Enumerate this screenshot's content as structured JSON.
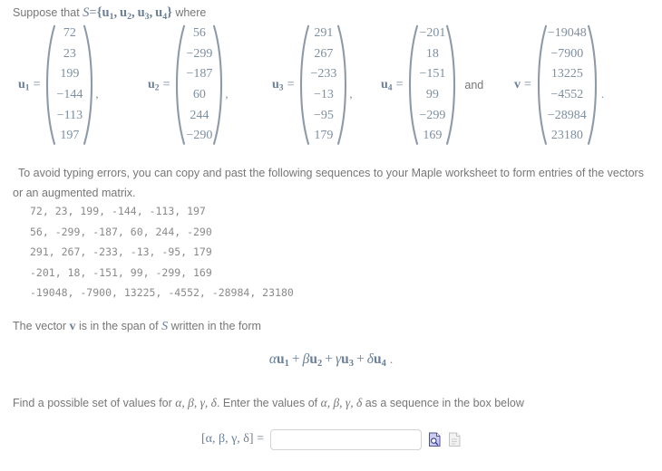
{
  "problem": {
    "intro_prefix": "Suppose that",
    "set_name": "S",
    "set_equals": "=",
    "set_contents": "{u1, u2, u3, u4}",
    "intro_suffix": "where",
    "equals_sign": "=",
    "connector_and": "and",
    "comma": ",",
    "trailing_period": "."
  },
  "vectors": [
    {
      "name": "u1",
      "name_base": "u",
      "name_sub": "1",
      "entries": [
        "72",
        "23",
        "199",
        "−144",
        "−113",
        "197"
      ]
    },
    {
      "name": "u2",
      "name_base": "u",
      "name_sub": "2",
      "entries": [
        "56",
        "−299",
        "−187",
        "60",
        "244",
        "−290"
      ]
    },
    {
      "name": "u3",
      "name_base": "u",
      "name_sub": "3",
      "entries": [
        "291",
        "267",
        "−233",
        "−13",
        "−95",
        "179"
      ]
    },
    {
      "name": "u4",
      "name_base": "u",
      "name_sub": "4",
      "entries": [
        "−201",
        "18",
        "−151",
        "99",
        "−299",
        "169"
      ]
    },
    {
      "name": "v",
      "name_base": "v",
      "name_sub": "",
      "entries": [
        "−19048",
        "−7900",
        "13225",
        "−4552",
        "−28984",
        "23180"
      ]
    }
  ],
  "copy_note": "To avoid typing errors, you can copy and past the following sequences to your Maple worksheet to form entries of the vectors or an augmented matrix.",
  "sequences": [
    "72, 23, 199, -144, -113, 197",
    "56, -299, -187, 60, 244, -290",
    "291, 267, -233, -13, -95, 179",
    "-201, 18, -151, 99, -299, 169",
    "-19048, -7900, 13225, -4552, -28984, 23180"
  ],
  "span_sentence": {
    "part1": "The vector",
    "vector": "v",
    "part2": "is in the span of",
    "set": "S",
    "part3": "written in the form"
  },
  "linear_combination": {
    "term1_coef": "α",
    "term1_vec": "u",
    "term1_sub": "1",
    "term2_coef": "β",
    "term2_vec": "u",
    "term2_sub": "2",
    "term3_coef": "γ",
    "term3_vec": "u",
    "term3_sub": "3",
    "term4_coef": "δ",
    "term4_vec": "u",
    "term4_sub": "4",
    "plus": "+",
    "trailing": "."
  },
  "find_sentence": {
    "part1": "Find a possible set of values for",
    "list1": "α, β, γ, δ",
    "part2": ". Enter the values of",
    "list2": "α, β, γ, δ",
    "part3": "as a sequence in the box below"
  },
  "answer": {
    "label": "[α, β, γ, δ] =",
    "value": "",
    "placeholder": "",
    "preview_icon": "document-preview-icon",
    "secondary_icon": "document-icon"
  },
  "colors": {
    "math": "#6b7f96",
    "body_text": "#777777",
    "mono_text": "#8a8a8a",
    "input_border": "#d3d3d3",
    "icon_blue": "#5a5fa8",
    "icon_fill": "#ccccf0",
    "icon_grey": "#c8c8c8",
    "background": "#ffffff"
  }
}
